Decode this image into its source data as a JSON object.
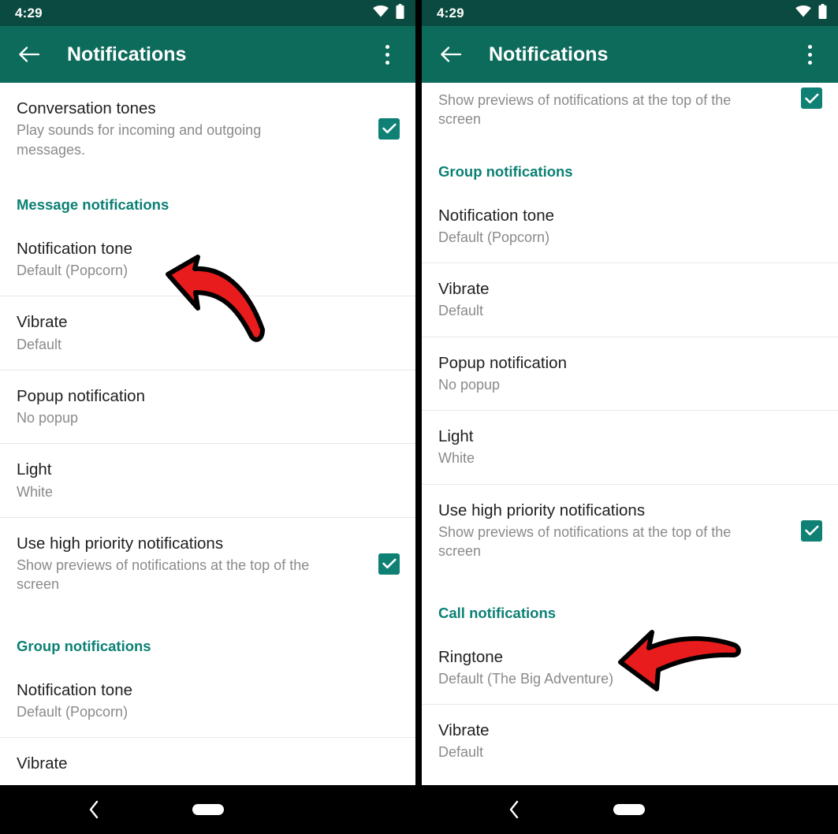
{
  "colors": {
    "status_bar": "#0b4a40",
    "app_bar": "#0d6b5b",
    "section_header": "#0b8074",
    "checkbox": "#0e8074",
    "arrow_fill": "#e81c1c",
    "arrow_outline": "#000000",
    "divider": "#e8e8e8",
    "title_text": "#1f1f1f",
    "subtitle_text": "#8a8a8a",
    "nav_bar": "#000000"
  },
  "icons": {
    "back": "arrow-left-icon",
    "overflow": "overflow-menu-icon",
    "wifi": "wifi-icon",
    "battery": "battery-icon",
    "checkbox": "checkbox-checked-icon",
    "nav_back": "nav-back-icon",
    "nav_home": "nav-home-pill-icon",
    "arrow_annotation": "red-arrow-annotation-icon"
  },
  "left_panel": {
    "status": {
      "time": "4:29",
      "wifi_label": "Wi-Fi",
      "battery_label": "Battery"
    },
    "app_bar": {
      "title": "Notifications",
      "back_label": "Back",
      "overflow_label": "More options"
    },
    "rows": [
      {
        "name": "conversation-tones",
        "title": "Conversation tones",
        "subtitle": "Play sounds for incoming and outgoing messages.",
        "checked": true,
        "divider": false
      },
      {
        "name": "section-message-notifications",
        "type": "section",
        "title": "Message notifications"
      },
      {
        "name": "notification-tone",
        "title": "Notification tone",
        "subtitle": "Default (Popcorn)",
        "checked": false,
        "divider": false
      },
      {
        "name": "vibrate",
        "title": "Vibrate",
        "subtitle": "Default",
        "checked": false,
        "divider": true
      },
      {
        "name": "popup-notification",
        "title": "Popup notification",
        "subtitle": "No popup",
        "checked": false,
        "divider": true
      },
      {
        "name": "light",
        "title": "Light",
        "subtitle": "White",
        "checked": false,
        "divider": true
      },
      {
        "name": "use-high-priority-notifications",
        "title": "Use high priority notifications",
        "subtitle": "Show previews of notifications at the top of the screen",
        "checked": true,
        "divider": true
      },
      {
        "name": "section-group-notifications",
        "type": "section",
        "title": "Group notifications"
      },
      {
        "name": "group-notification-tone",
        "title": "Notification tone",
        "subtitle": "Default (Popcorn)",
        "checked": false,
        "divider": false
      },
      {
        "name": "group-vibrate",
        "title": "Vibrate",
        "subtitle": "",
        "checked": false,
        "divider": true
      }
    ]
  },
  "right_panel": {
    "status": {
      "time": "4:29",
      "wifi_label": "Wi-Fi",
      "battery_label": "Battery"
    },
    "app_bar": {
      "title": "Notifications",
      "back_label": "Back",
      "overflow_label": "More options"
    },
    "rows": [
      {
        "name": "use-high-priority-notifications-clipped",
        "title": "",
        "subtitle": "Show previews of notifications at the top of the screen",
        "checked": true,
        "divider": false
      },
      {
        "name": "section-group-notifications",
        "type": "section",
        "title": "Group notifications"
      },
      {
        "name": "group-notification-tone",
        "title": "Notification tone",
        "subtitle": "Default (Popcorn)",
        "checked": false,
        "divider": false
      },
      {
        "name": "group-vibrate",
        "title": "Vibrate",
        "subtitle": "Default",
        "checked": false,
        "divider": true
      },
      {
        "name": "group-popup-notification",
        "title": "Popup notification",
        "subtitle": "No popup",
        "checked": false,
        "divider": true
      },
      {
        "name": "group-light",
        "title": "Light",
        "subtitle": "White",
        "checked": false,
        "divider": true
      },
      {
        "name": "group-use-high-priority-notifications",
        "title": "Use high priority notifications",
        "subtitle": "Show previews of notifications at the top of the screen",
        "checked": true,
        "divider": true
      },
      {
        "name": "section-call-notifications",
        "type": "section",
        "title": "Call notifications"
      },
      {
        "name": "ringtone",
        "title": "Ringtone",
        "subtitle": "Default (The Big Adventure)",
        "checked": false,
        "divider": false
      },
      {
        "name": "call-vibrate",
        "title": "Vibrate",
        "subtitle": "Default",
        "checked": false,
        "divider": true
      }
    ]
  },
  "nav_bar": {
    "back_label": "Back",
    "home_label": "Home"
  }
}
